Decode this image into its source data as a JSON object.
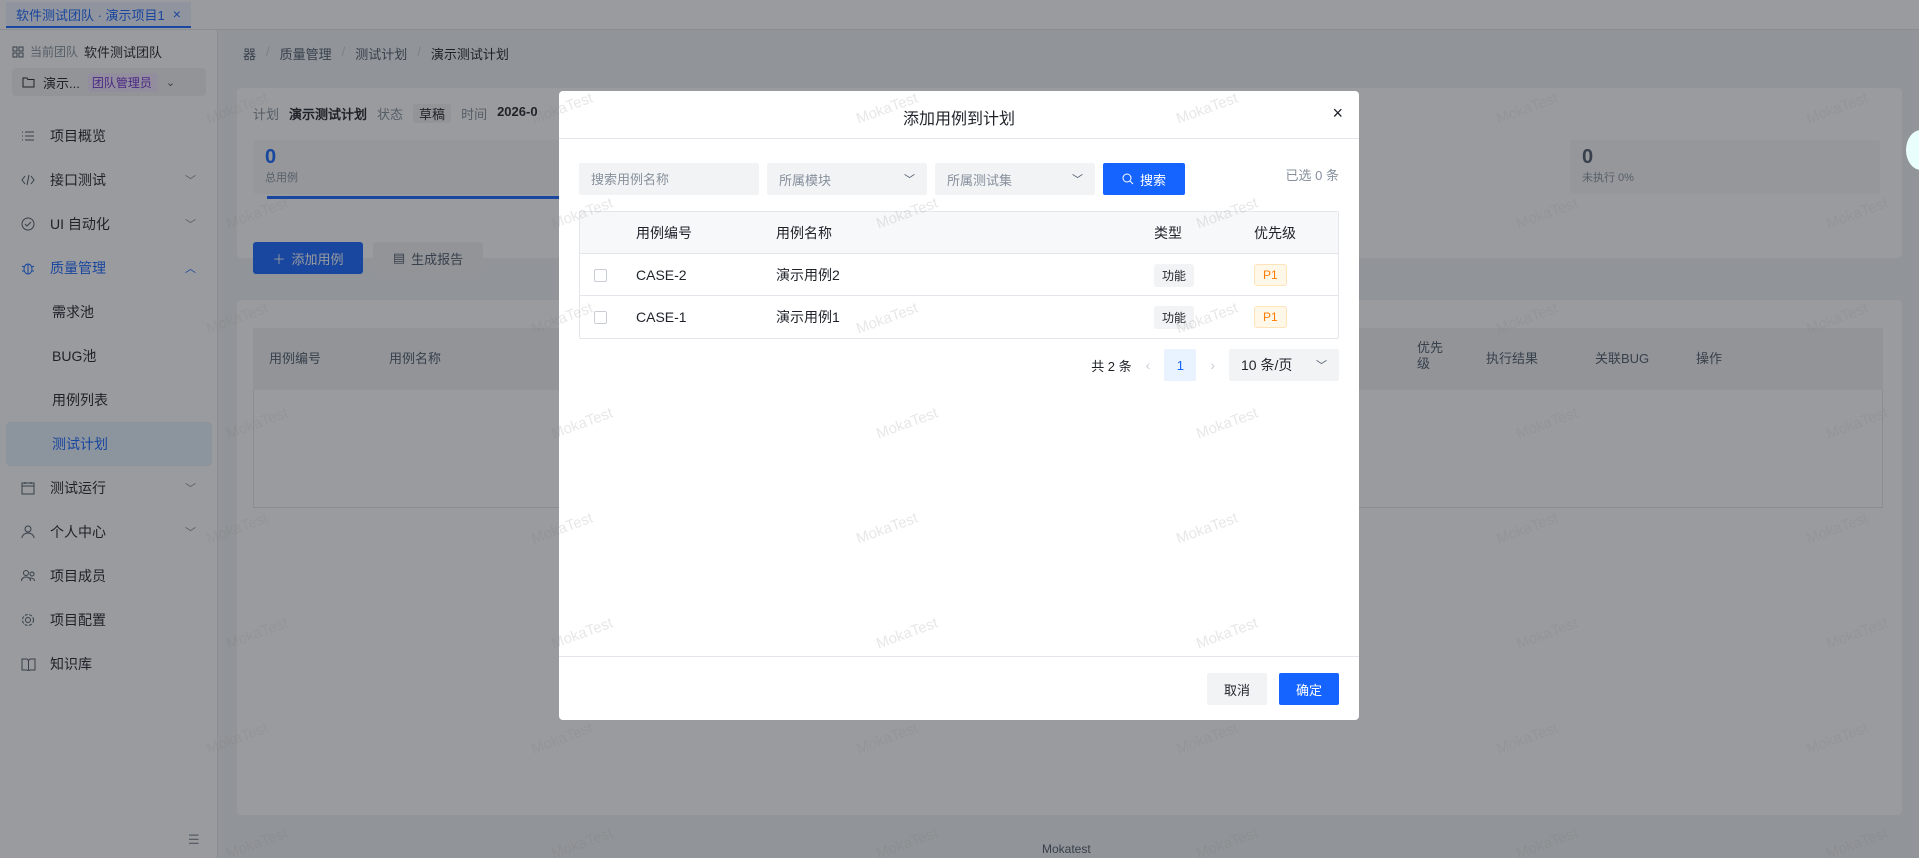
{
  "tab": {
    "label": "软件测试团队 · 演示项目1",
    "close": "×"
  },
  "sidebar": {
    "team_label": "当前团队",
    "team_name": "软件测试团队",
    "project_name": "演示...",
    "project_badge": "团队管理员",
    "items": [
      {
        "label": "项目概览",
        "icon": "list-icon"
      },
      {
        "label": "接口测试",
        "icon": "code-icon"
      },
      {
        "label": "UI 自动化",
        "icon": "check-circle-icon"
      },
      {
        "label": "质量管理",
        "icon": "bug-icon"
      },
      {
        "label": "测试运行",
        "icon": "calendar-icon"
      },
      {
        "label": "个人中心",
        "icon": "user-icon"
      },
      {
        "label": "项目成员",
        "icon": "team-icon"
      },
      {
        "label": "项目配置",
        "icon": "gear-icon"
      },
      {
        "label": "知识库",
        "icon": "book-icon"
      }
    ],
    "sub_items": [
      "需求池",
      "BUG池",
      "用例列表",
      "测试计划"
    ]
  },
  "breadcrumb": {
    "root": "器",
    "l1": "质量管理",
    "l2": "测试计划",
    "l3": "演示测试计划"
  },
  "plan": {
    "plan_label": "计划",
    "plan_name": "演示测试计划",
    "status_label": "状态",
    "status": "草稿",
    "time_label": "时间",
    "time_value": "2026-0",
    "total_num": "0",
    "total_caption": "总用例",
    "unexec_num": "0",
    "unexec_caption": "未执行 0%",
    "add_case": "添加用例",
    "gen_report": "生成报告"
  },
  "bg_table": {
    "headers": [
      "用例编号",
      "用例名称",
      "优先级",
      "执行结果",
      "关联BUG",
      "操作"
    ]
  },
  "footer": "Mokatest",
  "watermark": "MokaTest",
  "modal": {
    "title": "添加用例到计划",
    "close": "×",
    "search_placeholder": "搜索用例名称",
    "module_placeholder": "所属模块",
    "suite_placeholder": "所属测试集",
    "search_button": "搜索",
    "selected_count": "已选 0 条",
    "columns": [
      "用例编号",
      "用例名称",
      "类型",
      "优先级"
    ],
    "rows": [
      {
        "id": "CASE-2",
        "name": "演示用例2",
        "type": "功能",
        "priority": "P1"
      },
      {
        "id": "CASE-1",
        "name": "演示用例1",
        "type": "功能",
        "priority": "P1"
      }
    ],
    "pagination": {
      "total": "共 2 条",
      "prev": "‹",
      "page": "1",
      "next": "›",
      "page_size": "10 条/页"
    },
    "cancel": "取消",
    "confirm": "确定"
  },
  "colors": {
    "primary": "#1664ff",
    "priority_orange": "#ff7d00",
    "badge_purple": "#722ed1"
  }
}
